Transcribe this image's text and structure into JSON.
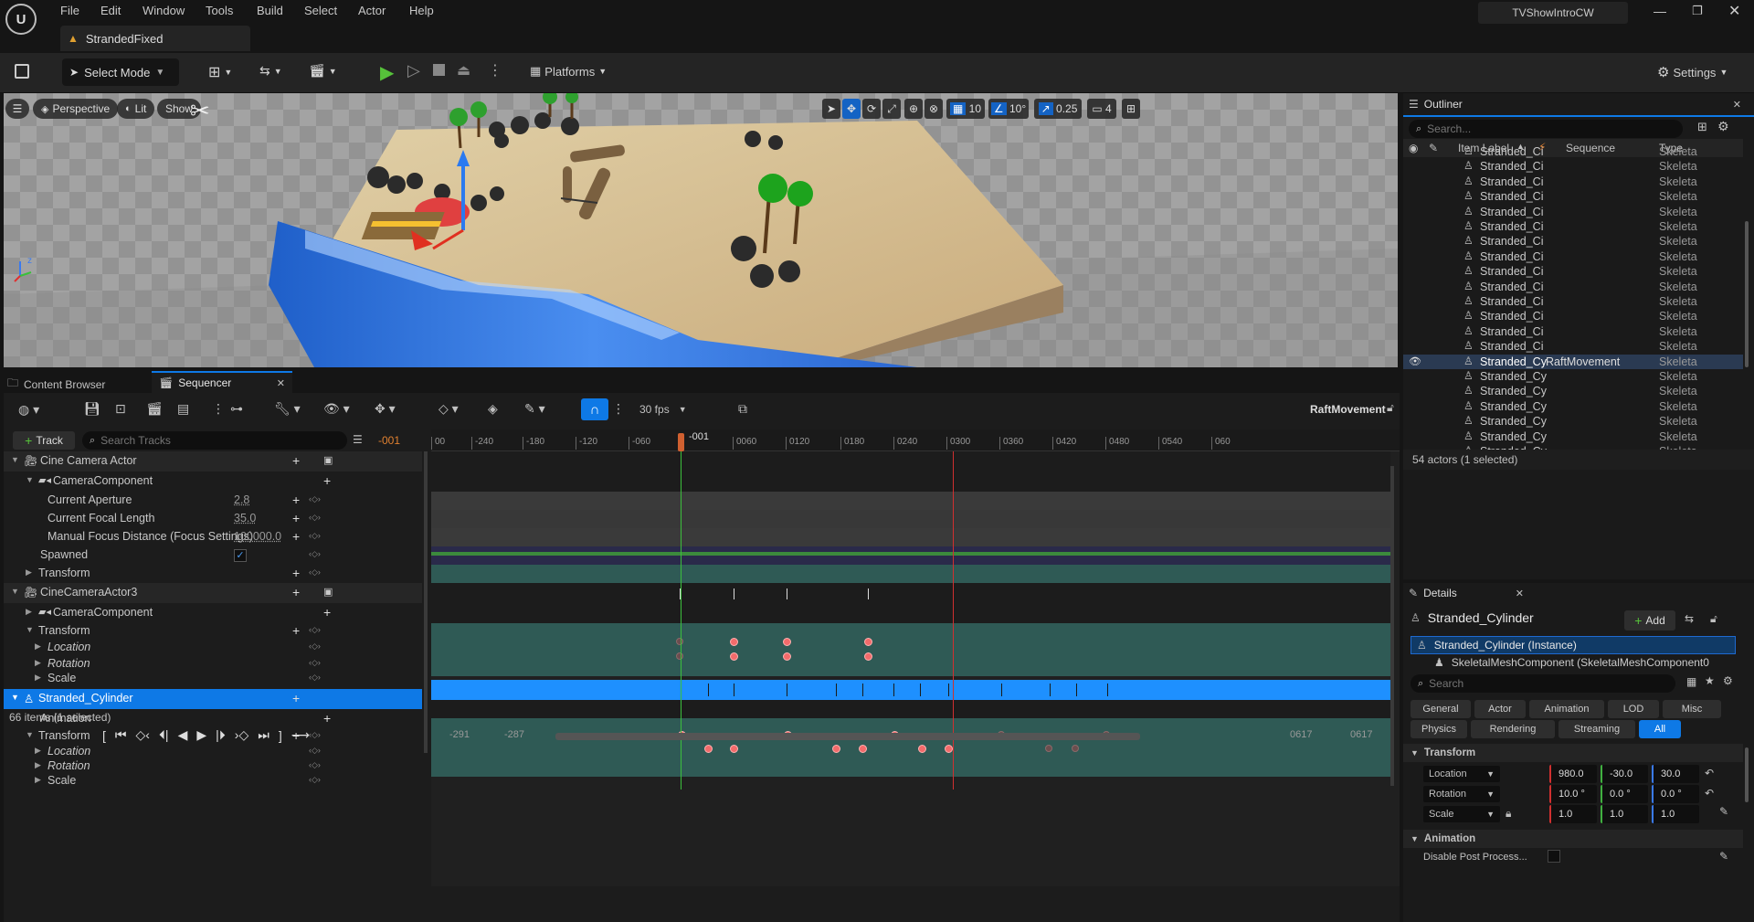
{
  "menu": [
    "File",
    "Edit",
    "Window",
    "Tools",
    "Build",
    "Select",
    "Actor",
    "Help"
  ],
  "project_name": "TVShowIntroCW",
  "level_tab": "StrandedFixed",
  "toolbar": {
    "select_mode": "Select Mode",
    "platforms": "Platforms",
    "settings": "Settings"
  },
  "viewport": {
    "perspective": "Perspective",
    "lit": "Lit",
    "show": "Show",
    "grid": "10",
    "angle": "10°",
    "scale": "0.25",
    "camera_speed": "4"
  },
  "bottom_tabs": {
    "content_browser": "Content Browser",
    "sequencer": "Sequencer"
  },
  "sequencer": {
    "fps": "30 fps",
    "sequence_name": "RaftMovement",
    "add_track": "Track",
    "search_placeholder": "Search Tracks",
    "current_frame": "-001",
    "playhead_label": "-001",
    "ruler_labels": [
      "00",
      "-240",
      "-180",
      "-120",
      "-060",
      "0060",
      "0120",
      "0180",
      "0240",
      "0300",
      "0360",
      "0420",
      "0480",
      "0540",
      "060"
    ],
    "items_count": "66 items (1 selected)",
    "range": {
      "start_a": "-291",
      "start_b": "-287",
      "end_a": "0617",
      "end_b": "0617"
    },
    "tracks": [
      {
        "label": "Cine Camera Actor"
      },
      {
        "label": "CameraComponent"
      },
      {
        "label": "Current Aperture",
        "value": "2.8"
      },
      {
        "label": "Current Focal Length",
        "value": "35.0"
      },
      {
        "label": "Manual Focus Distance (Focus Settings)",
        "value": "100000.0"
      },
      {
        "label": "Spawned"
      },
      {
        "label": "Transform"
      },
      {
        "label": "CineCameraActor3"
      },
      {
        "label": "CameraComponent"
      },
      {
        "label": "Transform"
      },
      {
        "label": "Location"
      },
      {
        "label": "Rotation"
      },
      {
        "label": "Scale"
      },
      {
        "label": "Stranded_Cylinder"
      },
      {
        "label": "Animation"
      },
      {
        "label": "Transform"
      },
      {
        "label": "Location"
      },
      {
        "label": "Rotation"
      },
      {
        "label": "Scale"
      }
    ]
  },
  "outliner": {
    "title": "Outliner",
    "search_placeholder": "Search...",
    "col_label": "Item Label",
    "col_sequence": "Sequence",
    "col_type": "Type",
    "rows": [
      {
        "label": "Stranded_Ci",
        "seq": "",
        "type": "Skeleta"
      },
      {
        "label": "Stranded_Ci",
        "seq": "",
        "type": "Skeleta"
      },
      {
        "label": "Stranded_Ci",
        "seq": "",
        "type": "Skeleta"
      },
      {
        "label": "Stranded_Ci",
        "seq": "",
        "type": "Skeleta"
      },
      {
        "label": "Stranded_Ci",
        "seq": "",
        "type": "Skeleta"
      },
      {
        "label": "Stranded_Ci",
        "seq": "",
        "type": "Skeleta"
      },
      {
        "label": "Stranded_Ci",
        "seq": "",
        "type": "Skeleta"
      },
      {
        "label": "Stranded_Ci",
        "seq": "",
        "type": "Skeleta"
      },
      {
        "label": "Stranded_Ci",
        "seq": "",
        "type": "Skeleta"
      },
      {
        "label": "Stranded_Ci",
        "seq": "",
        "type": "Skeleta"
      },
      {
        "label": "Stranded_Ci",
        "seq": "",
        "type": "Skeleta"
      },
      {
        "label": "Stranded_Ci",
        "seq": "",
        "type": "Skeleta"
      },
      {
        "label": "Stranded_Ci",
        "seq": "",
        "type": "Skeleta"
      },
      {
        "label": "Stranded_Ci",
        "seq": "",
        "type": "Skeleta"
      },
      {
        "label": "Stranded_Cy",
        "seq": "RaftMovement",
        "type": "Skeleta"
      },
      {
        "label": "Stranded_Cy",
        "seq": "",
        "type": "Skeleta"
      },
      {
        "label": "Stranded_Cy",
        "seq": "",
        "type": "Skeleta"
      },
      {
        "label": "Stranded_Cy",
        "seq": "",
        "type": "Skeleta"
      },
      {
        "label": "Stranded_Cy",
        "seq": "",
        "type": "Skeleta"
      },
      {
        "label": "Stranded_Cy",
        "seq": "",
        "type": "Skeleta"
      },
      {
        "label": "Stranded_Cy",
        "seq": "",
        "type": "Skeleta"
      }
    ],
    "status": "54 actors (1 selected)"
  },
  "details": {
    "title": "Details",
    "actor_name": "Stranded_Cylinder",
    "add": "Add",
    "instance": "Stranded_Cylinder (Instance)",
    "component": "SkeletalMeshComponent (SkeletalMeshComponent0",
    "search_placeholder": "Search",
    "filters_row1": [
      "General",
      "Actor",
      "Animation",
      "LOD",
      "Misc"
    ],
    "filters_row2": [
      "Physics",
      "Rendering",
      "Streaming",
      "All"
    ],
    "transform_header": "Transform",
    "location": {
      "label": "Location",
      "x": "980.0",
      "y": "-30.0",
      "z": "30.0"
    },
    "rotation": {
      "label": "Rotation",
      "x": "10.0 °",
      "y": "0.0 °",
      "z": "0.0 °"
    },
    "scale": {
      "label": "Scale",
      "x": "1.0",
      "y": "1.0",
      "z": "1.0"
    },
    "animation_header": "Animation",
    "disable_post": "Disable Post Process..."
  },
  "colors": {
    "accent": "#0e79e6",
    "keyframe": "#f26b6b",
    "selection": "#1e90ff",
    "section": "#2f5a55"
  }
}
